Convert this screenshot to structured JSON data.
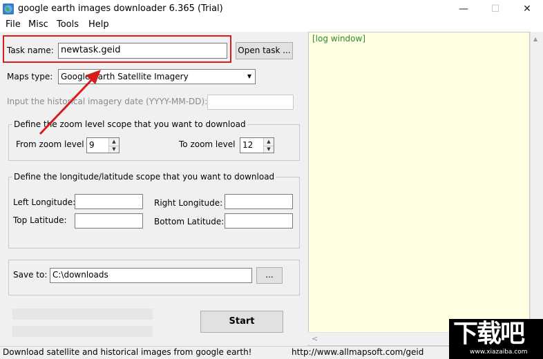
{
  "window": {
    "title": "google earth images downloader 6.365 (Trial)",
    "minimize": "—",
    "maximize": "☐",
    "close": "✕"
  },
  "menu": [
    "File",
    "Misc",
    "Tools",
    "Help"
  ],
  "task": {
    "label": "Task name:",
    "value": "newtask.geid",
    "open_button": "Open task ..."
  },
  "maps": {
    "label": "Maps type:",
    "value": "Google Earth Satellite Imagery"
  },
  "historical": {
    "label": "Input the  historical imagery date (YYYY-MM-DD):",
    "value": ""
  },
  "zoom": {
    "legend": "Define the zoom level scope that you want to download",
    "from_label": "From zoom level",
    "from_value": "9",
    "to_label": "To zoom level",
    "to_value": "12"
  },
  "coords": {
    "legend": "Define the longitude/latitude scope that you want to download",
    "left_lon_label": "Left Longitude:",
    "left_lon_value": "",
    "right_lon_label": "Right Longitude:",
    "right_lon_value": "",
    "top_lat_label": "Top Latitude:",
    "top_lat_value": "",
    "bottom_lat_label": "Bottom Latitude:",
    "bottom_lat_value": ""
  },
  "save": {
    "label": "Save to:",
    "value": "C:\\downloads",
    "browse_button": "..."
  },
  "start_button": "Start",
  "log": {
    "text": "[log window]"
  },
  "status": {
    "left": "Download satellite and historical  images from google earth!",
    "right": "http://www.allmapsoft.com/geid"
  },
  "watermark": {
    "main": "下载吧",
    "sub": "www.xiazaiba.com"
  },
  "colors": {
    "highlight": "#d81c1c",
    "log_bg": "#ffffe1",
    "log_text": "#2e8b2e"
  }
}
